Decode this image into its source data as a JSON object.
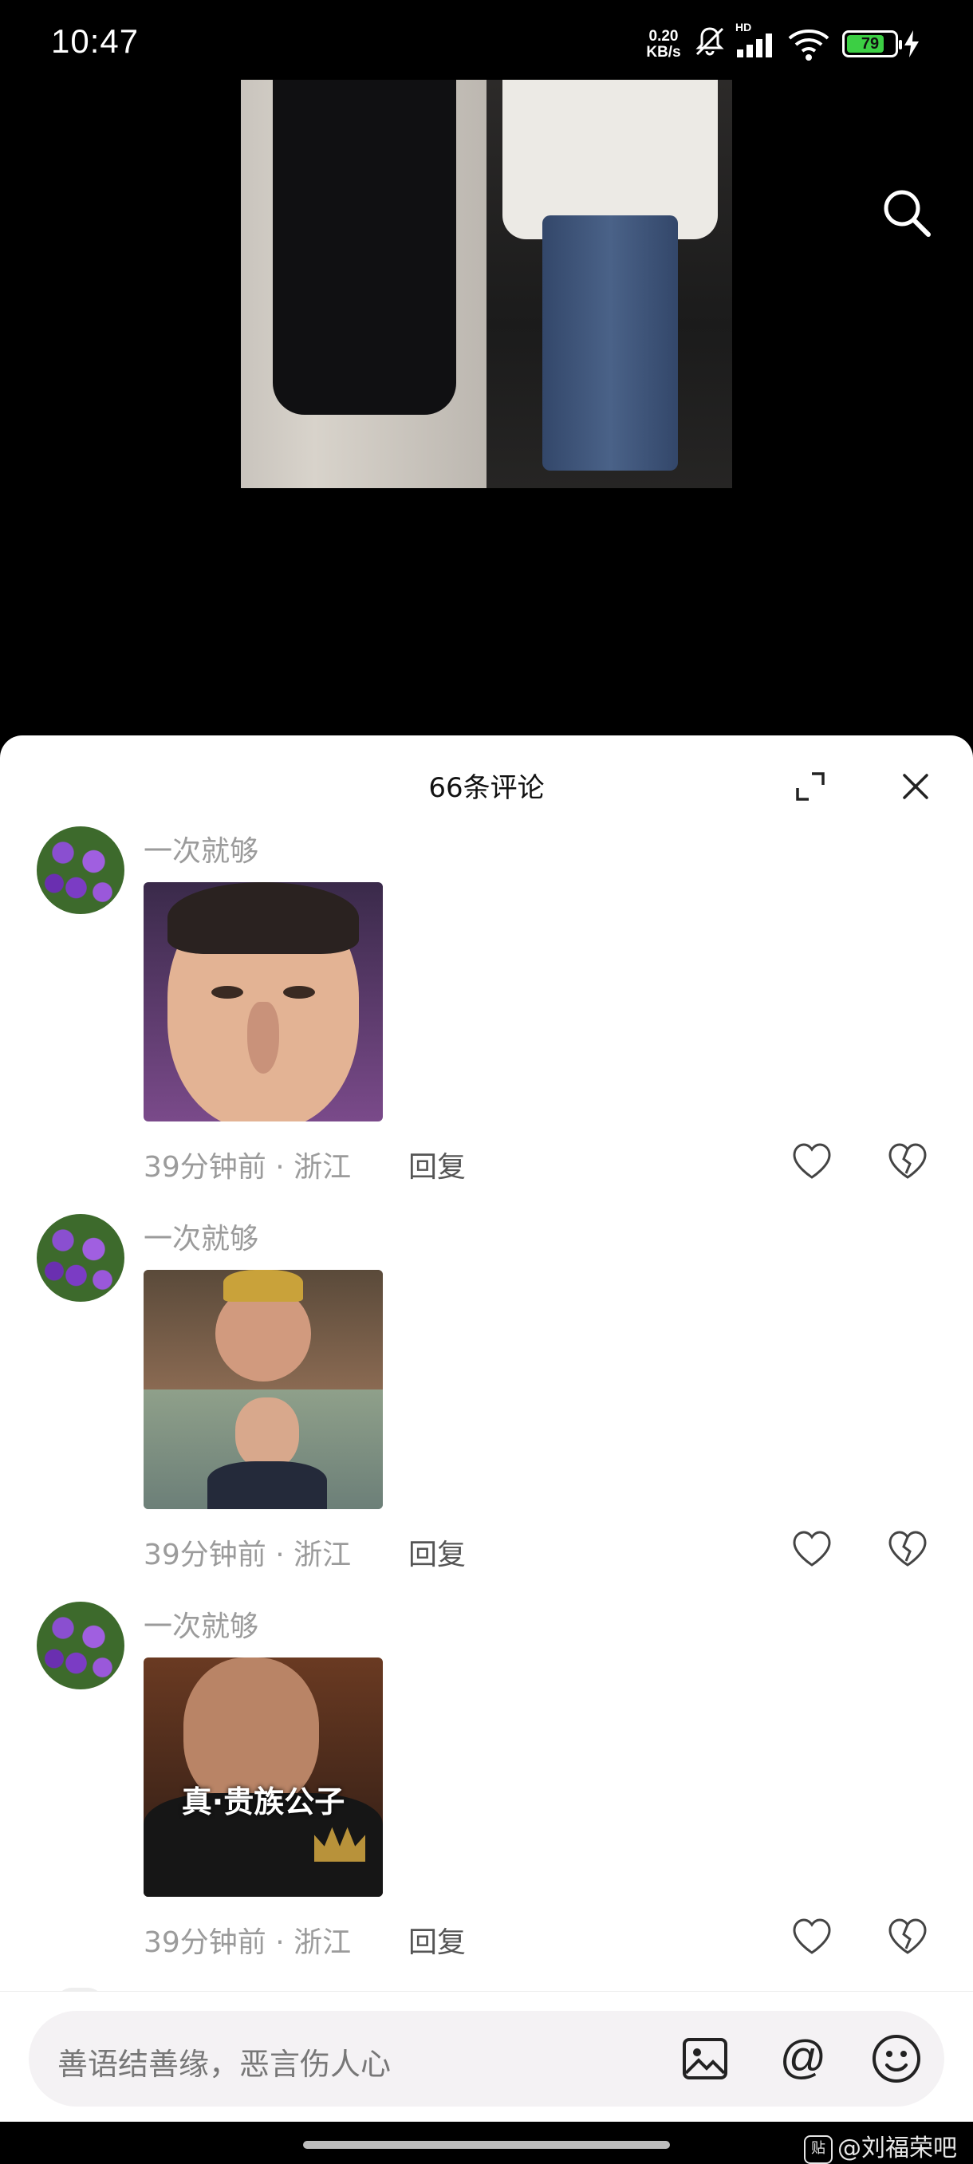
{
  "status_bar": {
    "time": "10:47",
    "net_speed_value": "0.20",
    "net_speed_unit": "KB/s",
    "signal_label": "HD",
    "battery_level": "79",
    "battery_percent": 79
  },
  "sheet": {
    "title": "66条评论"
  },
  "comments": [
    {
      "username": "一次就够",
      "time": "39分钟前",
      "location": "浙江",
      "reply_label": "回复"
    },
    {
      "username": "一次就够",
      "time": "39分钟前",
      "location": "浙江",
      "reply_label": "回复"
    },
    {
      "username": "一次就够",
      "time": "39分钟前",
      "location": "浙江",
      "reply_label": "回复",
      "sticker_caption": "真·贵族公子"
    }
  ],
  "input": {
    "placeholder": "善语结善缘，恶言伤人心",
    "at_symbol": "@"
  },
  "watermark": {
    "badge": "贴",
    "text": "@刘福荣吧"
  },
  "colors": {
    "accent_battery": "#3ccf44",
    "sheet_bg": "#ffffff",
    "secondary_text": "#9b9b9b"
  }
}
